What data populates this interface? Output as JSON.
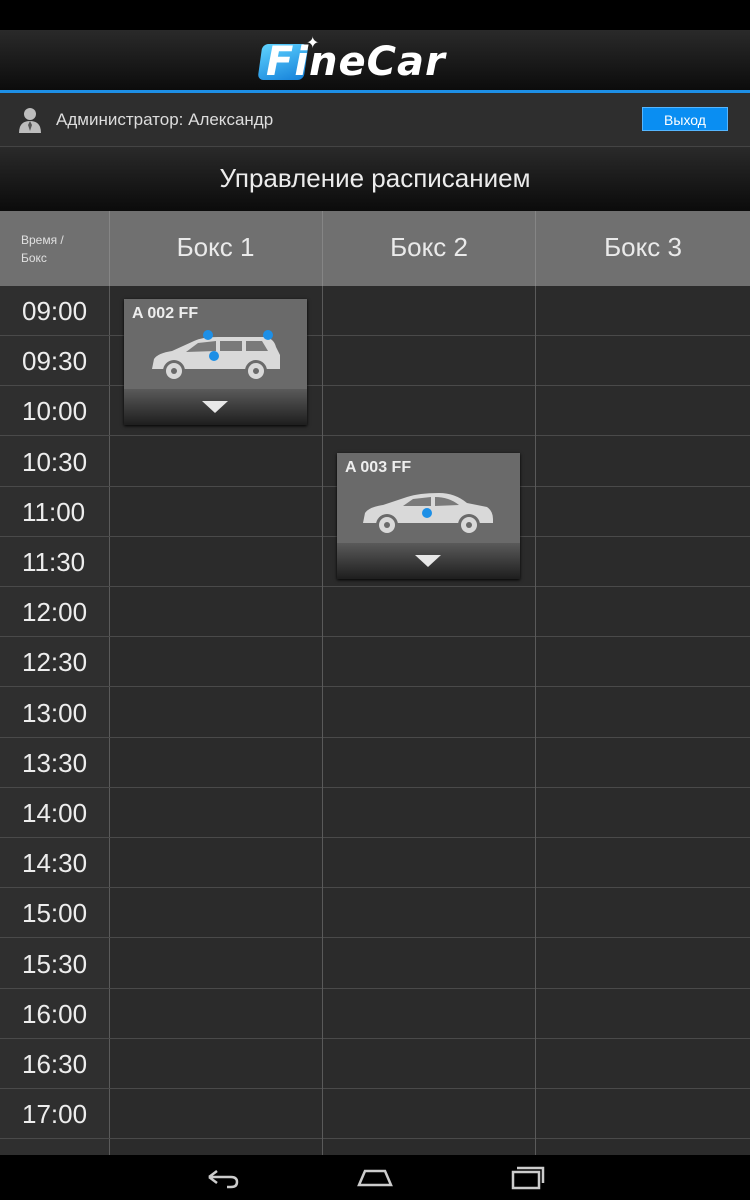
{
  "app": {
    "logo_text": "FineCar",
    "accent": "#1d8fe6",
    "logout_color": "#0a8ef2"
  },
  "user": {
    "name": "Администратор: Александр",
    "logout_label": "Выход",
    "icon": "user-icon"
  },
  "page": {
    "title": "Управление расписанием"
  },
  "grid": {
    "corner_label_line1": "Время /",
    "corner_label_line2": "Бокс",
    "boxes": [
      "Бокс 1",
      "Бокс 2",
      "Бокс 3"
    ],
    "times": [
      "09:00",
      "09:30",
      "10:00",
      "10:30",
      "11:00",
      "11:30",
      "12:00",
      "12:30",
      "13:00",
      "13:30",
      "14:00",
      "14:30",
      "15:00",
      "15:30",
      "16:00",
      "16:30",
      "17:00"
    ]
  },
  "bookings": [
    {
      "plate": "A 002 FF",
      "box": "Бокс 1",
      "start": "09:00",
      "car_type": "suv-icon"
    },
    {
      "plate": "A 003 FF",
      "box": "Бокс 2",
      "start": "10:30",
      "car_type": "sedan-icon"
    }
  ],
  "nav": {
    "back": "back-icon",
    "home": "home-icon",
    "recents": "recents-icon"
  }
}
